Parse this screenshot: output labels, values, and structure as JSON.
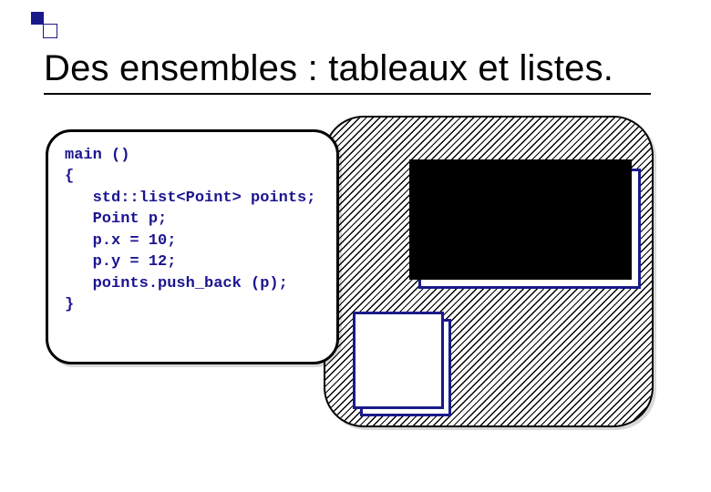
{
  "slide": {
    "title": "Des ensembles : tableaux et listes."
  },
  "code": {
    "l1": "main ()",
    "l2": "{",
    "l3": "   std::list<Point> points;",
    "l4": "",
    "l5": "   Point p;",
    "l6": "",
    "l7": "   p.x = 10;",
    "l8": "   p.y = 12;",
    "l9": "",
    "l10": "   points.push_back (p);",
    "l11": "}"
  }
}
